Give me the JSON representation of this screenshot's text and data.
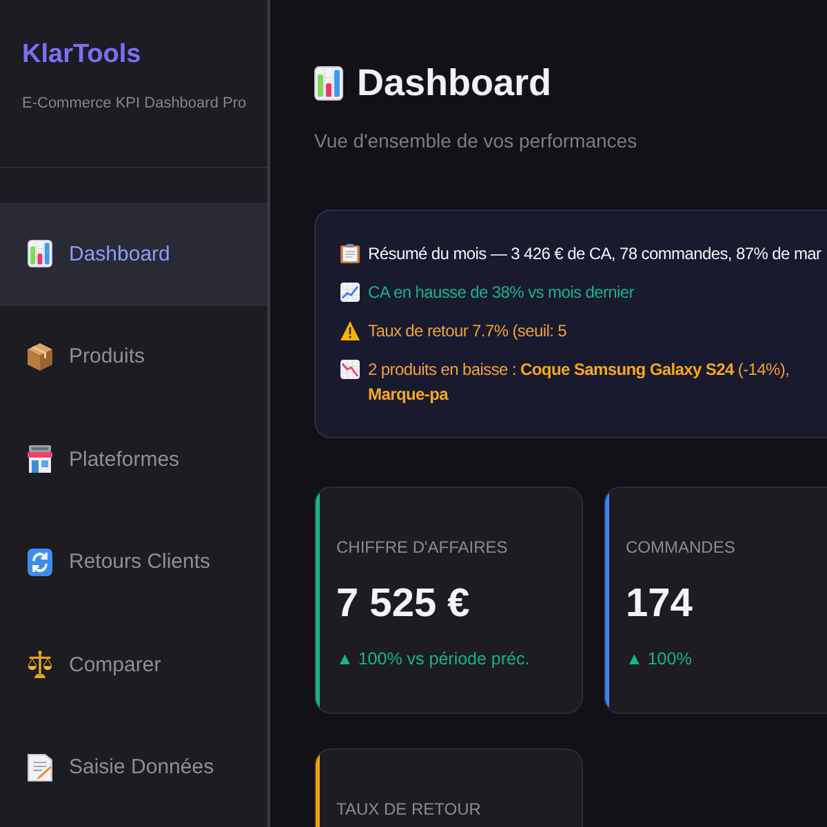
{
  "sidebar": {
    "logo": "KlarTools",
    "tagline": "E-Commerce KPI Dashboard Pro",
    "nav": [
      {
        "label": "Dashboard",
        "selected": true
      },
      {
        "label": "Produits",
        "selected": false
      },
      {
        "label": "Plateformes",
        "selected": false
      },
      {
        "label": "Retours Clients",
        "selected": false
      },
      {
        "label": "Comparer",
        "selected": false
      },
      {
        "label": "Saisie Données",
        "selected": false
      }
    ]
  },
  "header": {
    "title": "Dashboard",
    "subtitle": "Vue d'ensemble de vos performances"
  },
  "insights": [
    {
      "items": [
        {
          "kind": "summary",
          "text": "Résumé du mois — 3 426 € de CA, 78 commandes, 87% de mar"
        }
      ]
    },
    {
      "items": [
        {
          "kind": "positive",
          "text": "CA en hausse de 38% vs mois dernier"
        },
        {
          "kind": "warning",
          "text": "Taux de retour 7.7% (seuil: 5"
        }
      ]
    },
    {
      "items": [
        {
          "kind": "negative",
          "text": "2 produits en baisse : **Coque Samsung Galaxy S24** (-14%), **Marque-pa**"
        }
      ]
    }
  ],
  "kpis": [
    {
      "label": "CHIFFRE D'AFFAIRES",
      "value": "7 525 €",
      "change": "▲ 100% vs période préc.",
      "rising": true,
      "color": "#10b981"
    },
    {
      "label": "COMMANDES",
      "value": "174",
      "change": "▲ 100%",
      "rising": true,
      "color": "#3b82f6"
    },
    {
      "label": "TAUX DE RETOUR",
      "color": "#f59e0b"
    }
  ]
}
